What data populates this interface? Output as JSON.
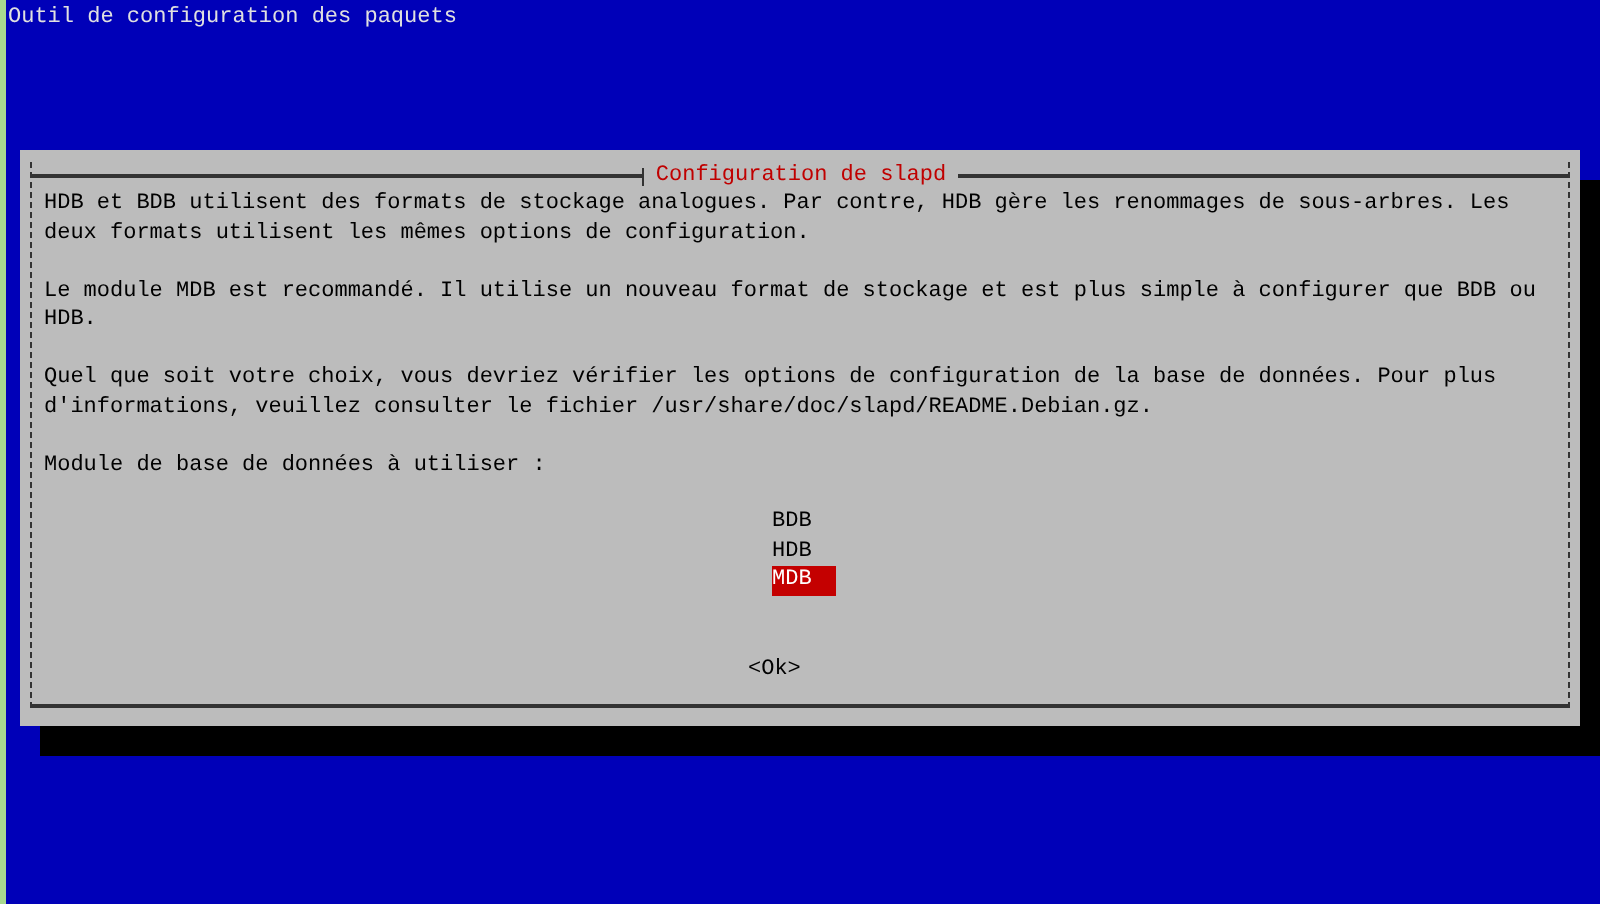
{
  "screen": {
    "title": "Outil de configuration des paquets"
  },
  "dialog": {
    "title": "Configuration de slapd",
    "paragraphs": [
      "HDB et BDB utilisent des formats de stockage analogues. Par contre, HDB gère les renommages de sous-arbres. Les deux formats utilisent les mêmes options de configuration.",
      "Le module MDB est recommandé. Il utilise un nouveau format de stockage et est plus simple à configurer que BDB ou HDB.",
      "Quel que soit votre choix, vous devriez vérifier les options de configuration de la base de données. Pour plus d'informations, veuillez consulter le fichier /usr/share/doc/slapd/README.Debian.gz."
    ],
    "prompt": "Module de base de données à utiliser :",
    "options": [
      {
        "label": "BDB",
        "selected": false
      },
      {
        "label": "HDB",
        "selected": false
      },
      {
        "label": "MDB",
        "selected": true
      }
    ],
    "buttons": [
      "<Ok>"
    ]
  }
}
